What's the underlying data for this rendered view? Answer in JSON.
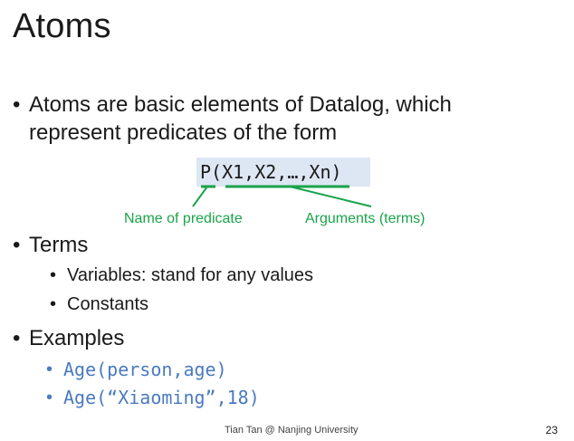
{
  "slide": {
    "title": "Atoms",
    "bullets": {
      "atoms_line1": "Atoms are basic elements of Datalog, which",
      "atoms_line2": "represent predicates of the form",
      "terms": "Terms",
      "variables": "Variables: stand for any values",
      "constants": "Constants",
      "examples": "Examples",
      "example1": "Age(person,age)",
      "example2": "Age(“Xiaoming”,18)"
    },
    "form": "P(X1,X2,…,Xn)",
    "annotations": {
      "predicate_name": "Name of predicate",
      "arguments": "Arguments (terms)"
    },
    "bullet_symbol": "•",
    "footer": "Tian Tan @ Nanjing University",
    "page_number": "23",
    "colors": {
      "annotation_green": "#1aa34a",
      "code_blue": "#4a7bbf",
      "form_background": "#dde6f3"
    }
  }
}
